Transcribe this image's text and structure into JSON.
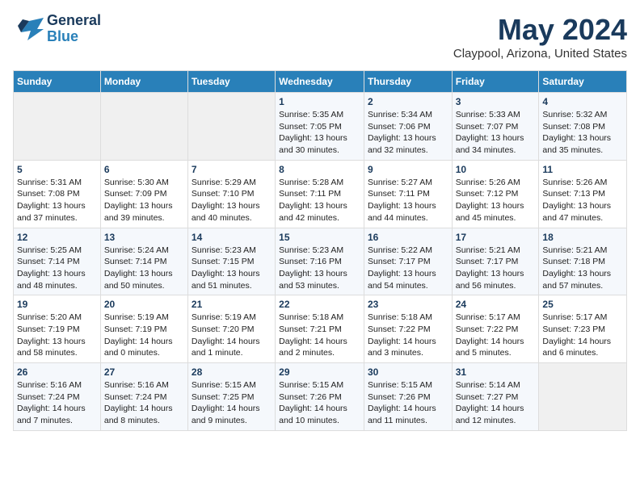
{
  "header": {
    "logo_general": "General",
    "logo_blue": "Blue",
    "main_title": "May 2024",
    "subtitle": "Claypool, Arizona, United States"
  },
  "weekdays": [
    "Sunday",
    "Monday",
    "Tuesday",
    "Wednesday",
    "Thursday",
    "Friday",
    "Saturday"
  ],
  "weeks": [
    [
      {
        "day": "",
        "info": ""
      },
      {
        "day": "",
        "info": ""
      },
      {
        "day": "",
        "info": ""
      },
      {
        "day": "1",
        "info": "Sunrise: 5:35 AM\nSunset: 7:05 PM\nDaylight: 13 hours\nand 30 minutes."
      },
      {
        "day": "2",
        "info": "Sunrise: 5:34 AM\nSunset: 7:06 PM\nDaylight: 13 hours\nand 32 minutes."
      },
      {
        "day": "3",
        "info": "Sunrise: 5:33 AM\nSunset: 7:07 PM\nDaylight: 13 hours\nand 34 minutes."
      },
      {
        "day": "4",
        "info": "Sunrise: 5:32 AM\nSunset: 7:08 PM\nDaylight: 13 hours\nand 35 minutes."
      }
    ],
    [
      {
        "day": "5",
        "info": "Sunrise: 5:31 AM\nSunset: 7:08 PM\nDaylight: 13 hours\nand 37 minutes."
      },
      {
        "day": "6",
        "info": "Sunrise: 5:30 AM\nSunset: 7:09 PM\nDaylight: 13 hours\nand 39 minutes."
      },
      {
        "day": "7",
        "info": "Sunrise: 5:29 AM\nSunset: 7:10 PM\nDaylight: 13 hours\nand 40 minutes."
      },
      {
        "day": "8",
        "info": "Sunrise: 5:28 AM\nSunset: 7:11 PM\nDaylight: 13 hours\nand 42 minutes."
      },
      {
        "day": "9",
        "info": "Sunrise: 5:27 AM\nSunset: 7:11 PM\nDaylight: 13 hours\nand 44 minutes."
      },
      {
        "day": "10",
        "info": "Sunrise: 5:26 AM\nSunset: 7:12 PM\nDaylight: 13 hours\nand 45 minutes."
      },
      {
        "day": "11",
        "info": "Sunrise: 5:26 AM\nSunset: 7:13 PM\nDaylight: 13 hours\nand 47 minutes."
      }
    ],
    [
      {
        "day": "12",
        "info": "Sunrise: 5:25 AM\nSunset: 7:14 PM\nDaylight: 13 hours\nand 48 minutes."
      },
      {
        "day": "13",
        "info": "Sunrise: 5:24 AM\nSunset: 7:14 PM\nDaylight: 13 hours\nand 50 minutes."
      },
      {
        "day": "14",
        "info": "Sunrise: 5:23 AM\nSunset: 7:15 PM\nDaylight: 13 hours\nand 51 minutes."
      },
      {
        "day": "15",
        "info": "Sunrise: 5:23 AM\nSunset: 7:16 PM\nDaylight: 13 hours\nand 53 minutes."
      },
      {
        "day": "16",
        "info": "Sunrise: 5:22 AM\nSunset: 7:17 PM\nDaylight: 13 hours\nand 54 minutes."
      },
      {
        "day": "17",
        "info": "Sunrise: 5:21 AM\nSunset: 7:17 PM\nDaylight: 13 hours\nand 56 minutes."
      },
      {
        "day": "18",
        "info": "Sunrise: 5:21 AM\nSunset: 7:18 PM\nDaylight: 13 hours\nand 57 minutes."
      }
    ],
    [
      {
        "day": "19",
        "info": "Sunrise: 5:20 AM\nSunset: 7:19 PM\nDaylight: 13 hours\nand 58 minutes."
      },
      {
        "day": "20",
        "info": "Sunrise: 5:19 AM\nSunset: 7:19 PM\nDaylight: 14 hours\nand 0 minutes."
      },
      {
        "day": "21",
        "info": "Sunrise: 5:19 AM\nSunset: 7:20 PM\nDaylight: 14 hours\nand 1 minute."
      },
      {
        "day": "22",
        "info": "Sunrise: 5:18 AM\nSunset: 7:21 PM\nDaylight: 14 hours\nand 2 minutes."
      },
      {
        "day": "23",
        "info": "Sunrise: 5:18 AM\nSunset: 7:22 PM\nDaylight: 14 hours\nand 3 minutes."
      },
      {
        "day": "24",
        "info": "Sunrise: 5:17 AM\nSunset: 7:22 PM\nDaylight: 14 hours\nand 5 minutes."
      },
      {
        "day": "25",
        "info": "Sunrise: 5:17 AM\nSunset: 7:23 PM\nDaylight: 14 hours\nand 6 minutes."
      }
    ],
    [
      {
        "day": "26",
        "info": "Sunrise: 5:16 AM\nSunset: 7:24 PM\nDaylight: 14 hours\nand 7 minutes."
      },
      {
        "day": "27",
        "info": "Sunrise: 5:16 AM\nSunset: 7:24 PM\nDaylight: 14 hours\nand 8 minutes."
      },
      {
        "day": "28",
        "info": "Sunrise: 5:15 AM\nSunset: 7:25 PM\nDaylight: 14 hours\nand 9 minutes."
      },
      {
        "day": "29",
        "info": "Sunrise: 5:15 AM\nSunset: 7:26 PM\nDaylight: 14 hours\nand 10 minutes."
      },
      {
        "day": "30",
        "info": "Sunrise: 5:15 AM\nSunset: 7:26 PM\nDaylight: 14 hours\nand 11 minutes."
      },
      {
        "day": "31",
        "info": "Sunrise: 5:14 AM\nSunset: 7:27 PM\nDaylight: 14 hours\nand 12 minutes."
      },
      {
        "day": "",
        "info": ""
      }
    ]
  ]
}
